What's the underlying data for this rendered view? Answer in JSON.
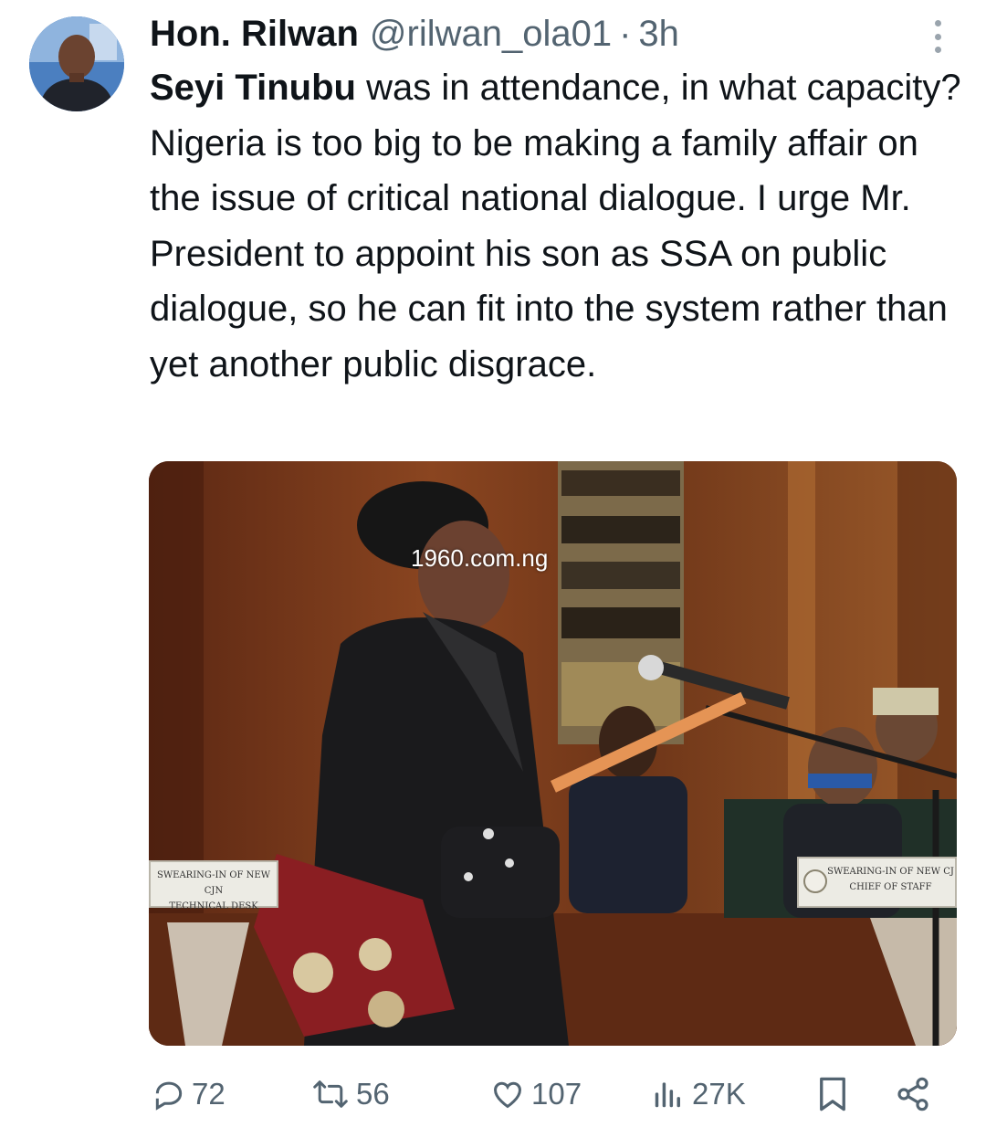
{
  "author": {
    "display_name": "Hon. Rilwan",
    "handle": "@rilwan_ola01",
    "separator": "·",
    "time": "3h"
  },
  "tweet": {
    "mention": "Seyi Tinubu",
    "body": " was in attendance, in what capacity? Nigeria is too big to be making a family affair on the issue of critical national dialogue. I urge Mr. President to appoint his son as SSA on public dialogue, so he can fit into the system rather than yet another public disgrace."
  },
  "media": {
    "watermark": "1960.com.ng",
    "sign_left_line1": "SWEARING-IN OF NEW CJN",
    "sign_left_line2": "TECHNICAL DESK",
    "sign_right_line1": "SWEARING-IN OF NEW CJ",
    "sign_right_line2": "CHIEF OF STAFF"
  },
  "actions": {
    "replies": "72",
    "reposts": "56",
    "likes": "107",
    "views": "27K"
  },
  "icons": [
    "more-icon",
    "reply-icon",
    "repost-icon",
    "like-icon",
    "views-icon",
    "bookmark-icon",
    "share-icon"
  ],
  "colors": {
    "text": "#0f1419",
    "secondary": "#536471"
  }
}
